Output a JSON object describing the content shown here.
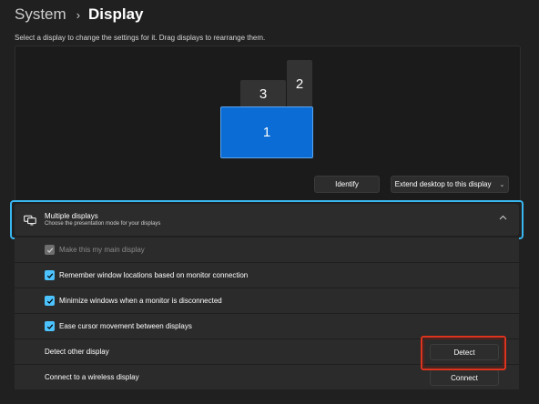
{
  "breadcrumb": {
    "parent": "System",
    "separator": "›",
    "current": "Display"
  },
  "instructions": "Select a display to change the settings for it. Drag displays to rearrange them.",
  "monitors": [
    {
      "label": "1",
      "selected": true
    },
    {
      "label": "2",
      "selected": false
    },
    {
      "label": "3",
      "selected": false
    }
  ],
  "buttons": {
    "identify": "Identify",
    "extend": "Extend desktop to this display",
    "extend_icon": "chevron-down-icon"
  },
  "multiple_displays": {
    "title": "Multiple displays",
    "subtitle": "Choose the presentation mode for your displays",
    "icon": "multiple-displays-icon",
    "expand_icon": "chevron-up-icon",
    "expanded": true
  },
  "options": [
    {
      "label": "Make this my main display",
      "checked": true,
      "disabled": true
    },
    {
      "label": "Remember window locations based on monitor connection",
      "checked": true,
      "disabled": false
    },
    {
      "label": "Minimize windows when a monitor is disconnected",
      "checked": true,
      "disabled": false
    },
    {
      "label": "Ease cursor movement between displays",
      "checked": true,
      "disabled": false
    }
  ],
  "detect": {
    "label": "Detect other display",
    "button": "Detect"
  },
  "wireless": {
    "label": "Connect to a wireless display",
    "button": "Connect"
  },
  "colors": {
    "accent": "#4cc2ff",
    "selected_monitor": "#0a6cd4",
    "focus_outline": "#38b7f0",
    "highlight_outline": "#e0321c"
  }
}
